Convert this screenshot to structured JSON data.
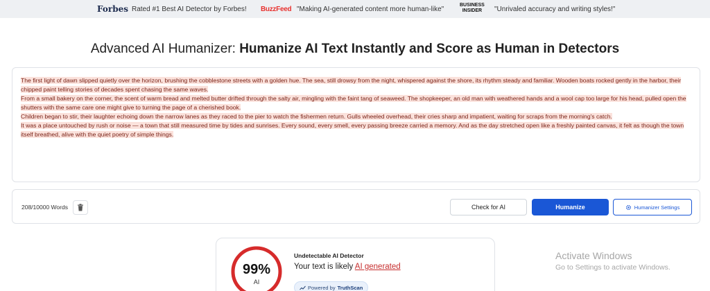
{
  "press_bar": {
    "forbes_brand": "Forbes",
    "forbes_quote": "Rated #1 Best AI Detector by Forbes!",
    "buzzfeed_brand": "BuzzFeed",
    "buzzfeed_quote": "\"Making AI-generated content more human-like\"",
    "business_insider_brand_line1": "BUSINESS",
    "business_insider_brand_line2": "INSIDER",
    "business_insider_quote": "\"Unrivaled accuracy and writing styles!\""
  },
  "headline": {
    "lead": "Advanced AI Humanizer: ",
    "strong": "Humanize AI Text Instantly and Score as Human in Detectors"
  },
  "editor": {
    "paragraphs": [
      "The first light of dawn slipped quietly over the horizon, brushing the cobblestone streets with a golden hue. The sea, still drowsy from the night, whispered against the shore, its rhythm steady and familiar. Wooden boats rocked gently in the harbor, their chipped paint telling stories of decades spent chasing the same waves.",
      " From a small bakery on the corner, the scent of warm bread and melted butter drifted through the salty air, mingling with the faint tang of seaweed. The shopkeeper, an old man with weathered hands and a wool cap too large for his head, pulled open the shutters with the same care one might give to turning the page of a cherished book.",
      " Children began to stir, their laughter echoing down the narrow lanes as they raced to the pier to watch the fishermen return. Gulls wheeled overhead, their cries sharp and impatient, waiting for scraps from the morning's catch.",
      " It was a place untouched by rush or noise — a town that still measured time by tides and sunrises. Every sound, every smell, every passing breeze carried a memory. And as the day stretched open like a freshly painted canvas, it felt as though the town itself breathed, alive with the quiet poetry of simple things."
    ],
    "highlight_color": "#fbe2dc",
    "text_color": "#7a2318"
  },
  "controls": {
    "word_count": "208/10000 Words",
    "trash_icon": "trash-icon",
    "check_label": "Check for AI",
    "humanize_label": "Humanize",
    "settings_label": "Humanizer Settings",
    "settings_icon": "gear-icon",
    "accent_color": "#1a57d6"
  },
  "detector": {
    "percent": "99%",
    "percent_value": 99,
    "percent_caption": "AI",
    "title": "Undetectable AI Detector",
    "result_prefix": "Your text is likely ",
    "result_link": "AI generated",
    "powered_prefix": "Powered by ",
    "powered_brand": "TruthScan",
    "gauge_color": "#d62b2b"
  },
  "os_watermark": {
    "line1": "Activate Windows",
    "line2": "Go to Settings to activate Windows."
  }
}
